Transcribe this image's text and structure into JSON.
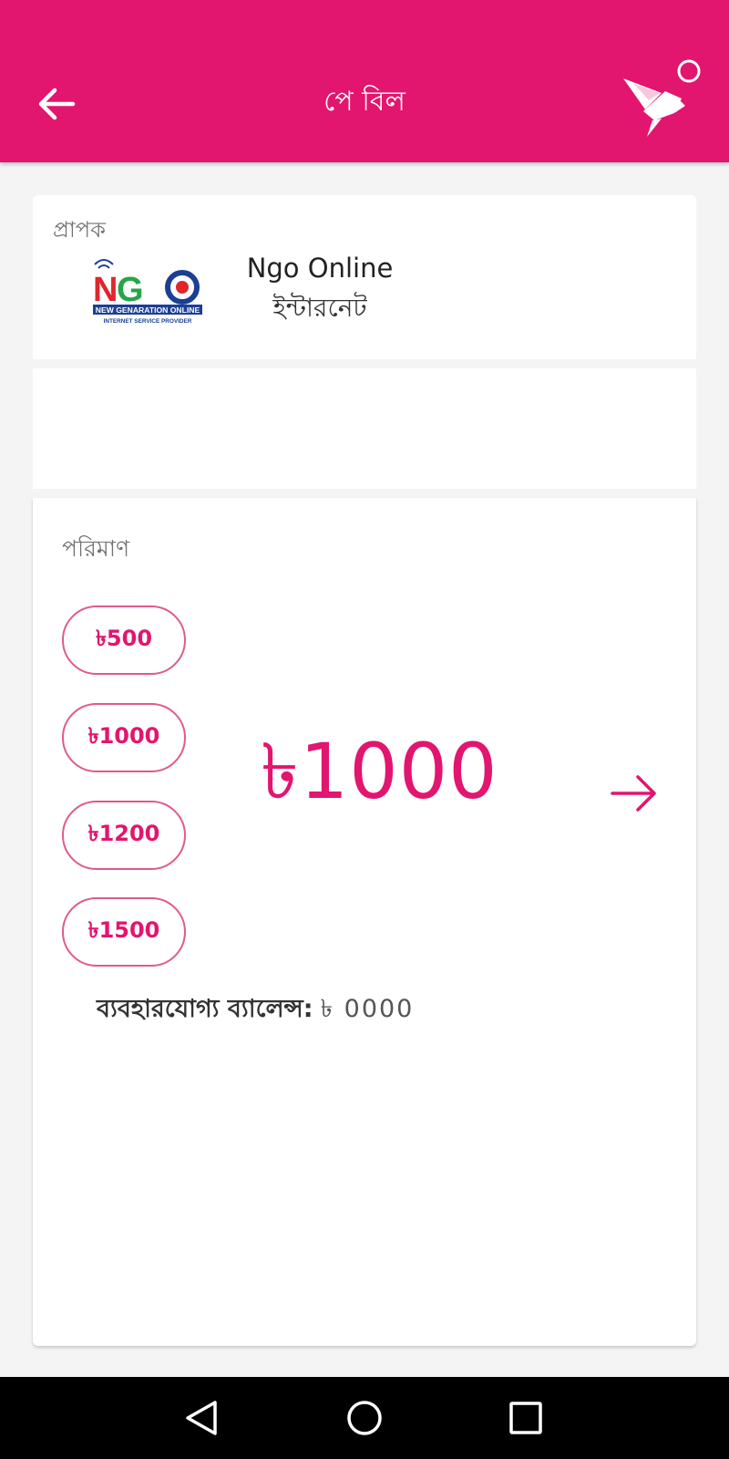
{
  "appbar": {
    "title": "পে বিল",
    "back_icon": "arrow-left-icon",
    "brand_icon": "origami-bird-icon",
    "color": "#e2156f"
  },
  "recipient": {
    "label": "প্রাপক",
    "name": "Ngo Online",
    "type": "ইন্টারনেট",
    "logo": {
      "text": "NGO",
      "line1": "NEW GENARATION ONLINE",
      "line2": "INTERNET SERVICE PROVIDER"
    }
  },
  "amount": {
    "label": "পরিমাণ",
    "presets": [
      "৳500",
      "৳1000",
      "৳1200",
      "৳1500"
    ],
    "selected": "৳1000",
    "next_icon": "arrow-right-icon"
  },
  "balance": {
    "label": "ব্যবহারযোগ্য ব্যালেন্স:",
    "value": "৳ 0000"
  },
  "navbar": {
    "back_icon": "triangle-back-icon",
    "home_icon": "circle-home-icon",
    "recent_icon": "square-recents-icon"
  }
}
